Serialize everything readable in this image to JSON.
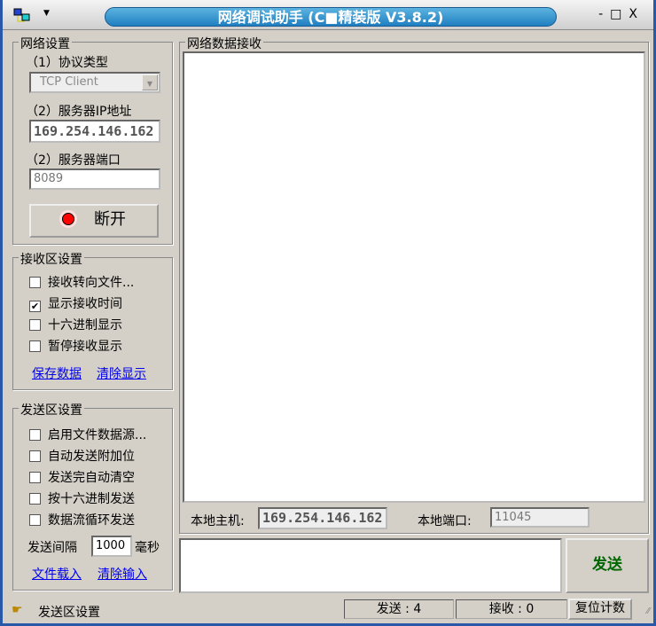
{
  "window": {
    "title": "网络调试助手 (C■精装版 V3.8.2)",
    "minimize": "-",
    "maximize": "□",
    "close": "X"
  },
  "network": {
    "title": "网络设置",
    "protocol_label": "（1）协议类型",
    "protocol_value": "TCP Client",
    "ip_label": "（2）服务器IP地址",
    "ip_value": "169.254.146.162",
    "port_label": "（2）服务器端口",
    "port_value": "8089",
    "connect_button": "断开"
  },
  "receive_settings": {
    "title": "接收区设置",
    "options": [
      {
        "label": "接收转向文件...",
        "checked": false
      },
      {
        "label": "显示接收时间",
        "checked": true
      },
      {
        "label": "十六进制显示",
        "checked": false
      },
      {
        "label": "暂停接收显示",
        "checked": false
      }
    ],
    "save_link": "保存数据",
    "clear_link": "清除显示"
  },
  "send_settings": {
    "title": "发送区设置",
    "options": [
      {
        "label": "启用文件数据源...",
        "checked": false
      },
      {
        "label": "自动发送附加位",
        "checked": false
      },
      {
        "label": "发送完自动清空",
        "checked": false
      },
      {
        "label": "按十六进制发送",
        "checked": false
      },
      {
        "label": "数据流循环发送",
        "checked": false
      }
    ],
    "interval_label": "发送间隔",
    "interval_value": "1000",
    "interval_unit": "毫秒",
    "load_link": "文件载入",
    "clear_link": "清除输入"
  },
  "receive_area": {
    "title": "网络数据接收",
    "local_host_label": "本地主机:",
    "local_host_value": "169.254.146.162",
    "local_port_label": "本地端口:",
    "local_port_value": "11045"
  },
  "send_area": {
    "send_button": "发送"
  },
  "status": {
    "text": "发送区设置",
    "sent": "发送 : 4",
    "received": "接收 : 0",
    "reset_button": "复位计数"
  }
}
